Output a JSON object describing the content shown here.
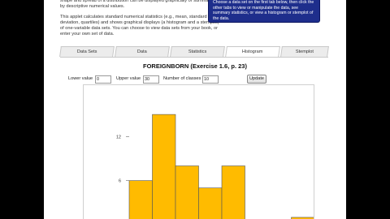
{
  "intro": {
    "p1": "shape and spread of a distribution can be displayed graphically or summarized by descriptive numerical values.",
    "p2": "This applet calculates standard numerical statistics (e.g., mean, standard deviation, quartiles) and shows graphical displays (a histogram and a stemplot) of one-variable data sets. You can choose to view data sets from your book, or enter your own set of data."
  },
  "notice": "Choose a data set on the first tab below, then click the other tabs to view or manipulate the data, see summary statistics, or view a histogram or stemplot of the data.",
  "tabs": [
    {
      "label": "Data Sets",
      "active": false
    },
    {
      "label": "Data",
      "active": false
    },
    {
      "label": "Statistics",
      "active": false
    },
    {
      "label": "Histogram",
      "active": true
    },
    {
      "label": "Stemplot",
      "active": false
    }
  ],
  "title": "FOREIGNBORN (Exercise 1.6, p. 23)",
  "controls": {
    "lower_label": "Lower value",
    "lower_value": "0",
    "upper_label": "Upper value",
    "upper_value": "30",
    "classes_label": "Number of classes",
    "classes_value": "10",
    "update_label": "Update"
  },
  "chart_data": {
    "type": "bar",
    "title": "",
    "xlabel": "",
    "ylabel": "",
    "ylim": [
      0,
      17
    ],
    "yticks": [
      6,
      12
    ],
    "bar_color": "#ffbb00",
    "bar_edge_color": "#555555",
    "bins": [
      [
        0,
        3
      ],
      [
        3,
        6
      ],
      [
        6,
        9
      ],
      [
        9,
        12
      ],
      [
        12,
        15
      ],
      [
        15,
        18
      ],
      [
        18,
        21
      ],
      [
        21,
        24
      ],
      [
        24,
        27
      ],
      [
        27,
        30
      ]
    ],
    "values": [
      6,
      15,
      8,
      5,
      8,
      0,
      0,
      1,
      0,
      0
    ]
  }
}
